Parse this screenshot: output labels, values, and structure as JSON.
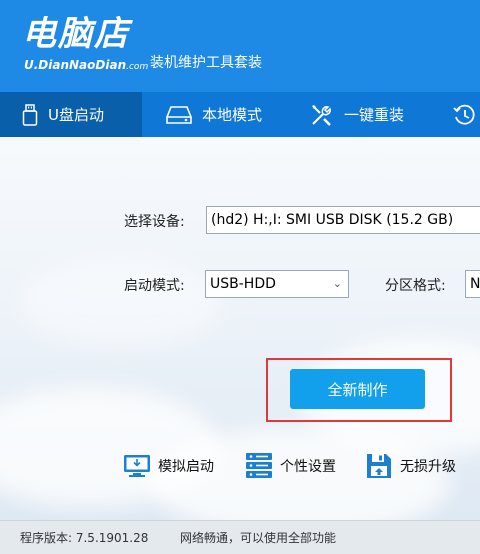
{
  "header": {
    "logo_text": "电脑店",
    "logo_url": "U.DianNaoDian",
    "logo_url_suffix": ".com",
    "tagline": "装机维护工具套装"
  },
  "tabs": [
    {
      "label": "U盘启动",
      "icon": "usb-drive-icon",
      "active": true
    },
    {
      "label": "本地模式",
      "icon": "hard-drive-icon",
      "active": false
    },
    {
      "label": "一键重装",
      "icon": "tools-icon",
      "active": false
    },
    {
      "label": "",
      "icon": "history-icon",
      "active": false
    }
  ],
  "form": {
    "device_label": "选择设备:",
    "device_value": "(hd2) H:,I: SMI USB DISK (15.2 GB)",
    "boot_mode_label": "启动模式:",
    "boot_mode_value": "USB-HDD",
    "partition_label": "分区格式:",
    "partition_value": "N"
  },
  "actions": {
    "create_label": "全新制作"
  },
  "tools": [
    {
      "label": "模拟启动",
      "icon": "simulate-boot-icon"
    },
    {
      "label": "个性设置",
      "icon": "server-settings-icon"
    },
    {
      "label": "无损升级",
      "icon": "upgrade-icon"
    }
  ],
  "status": {
    "version": "程序版本: 7.5.1901.28",
    "network": "网络畅通，可以使用全部功能"
  },
  "colors": {
    "header_bg": "#1e8ae6",
    "tab_active": "#0a5fab",
    "primary": "#12a0ec",
    "highlight": "#e0383b"
  }
}
